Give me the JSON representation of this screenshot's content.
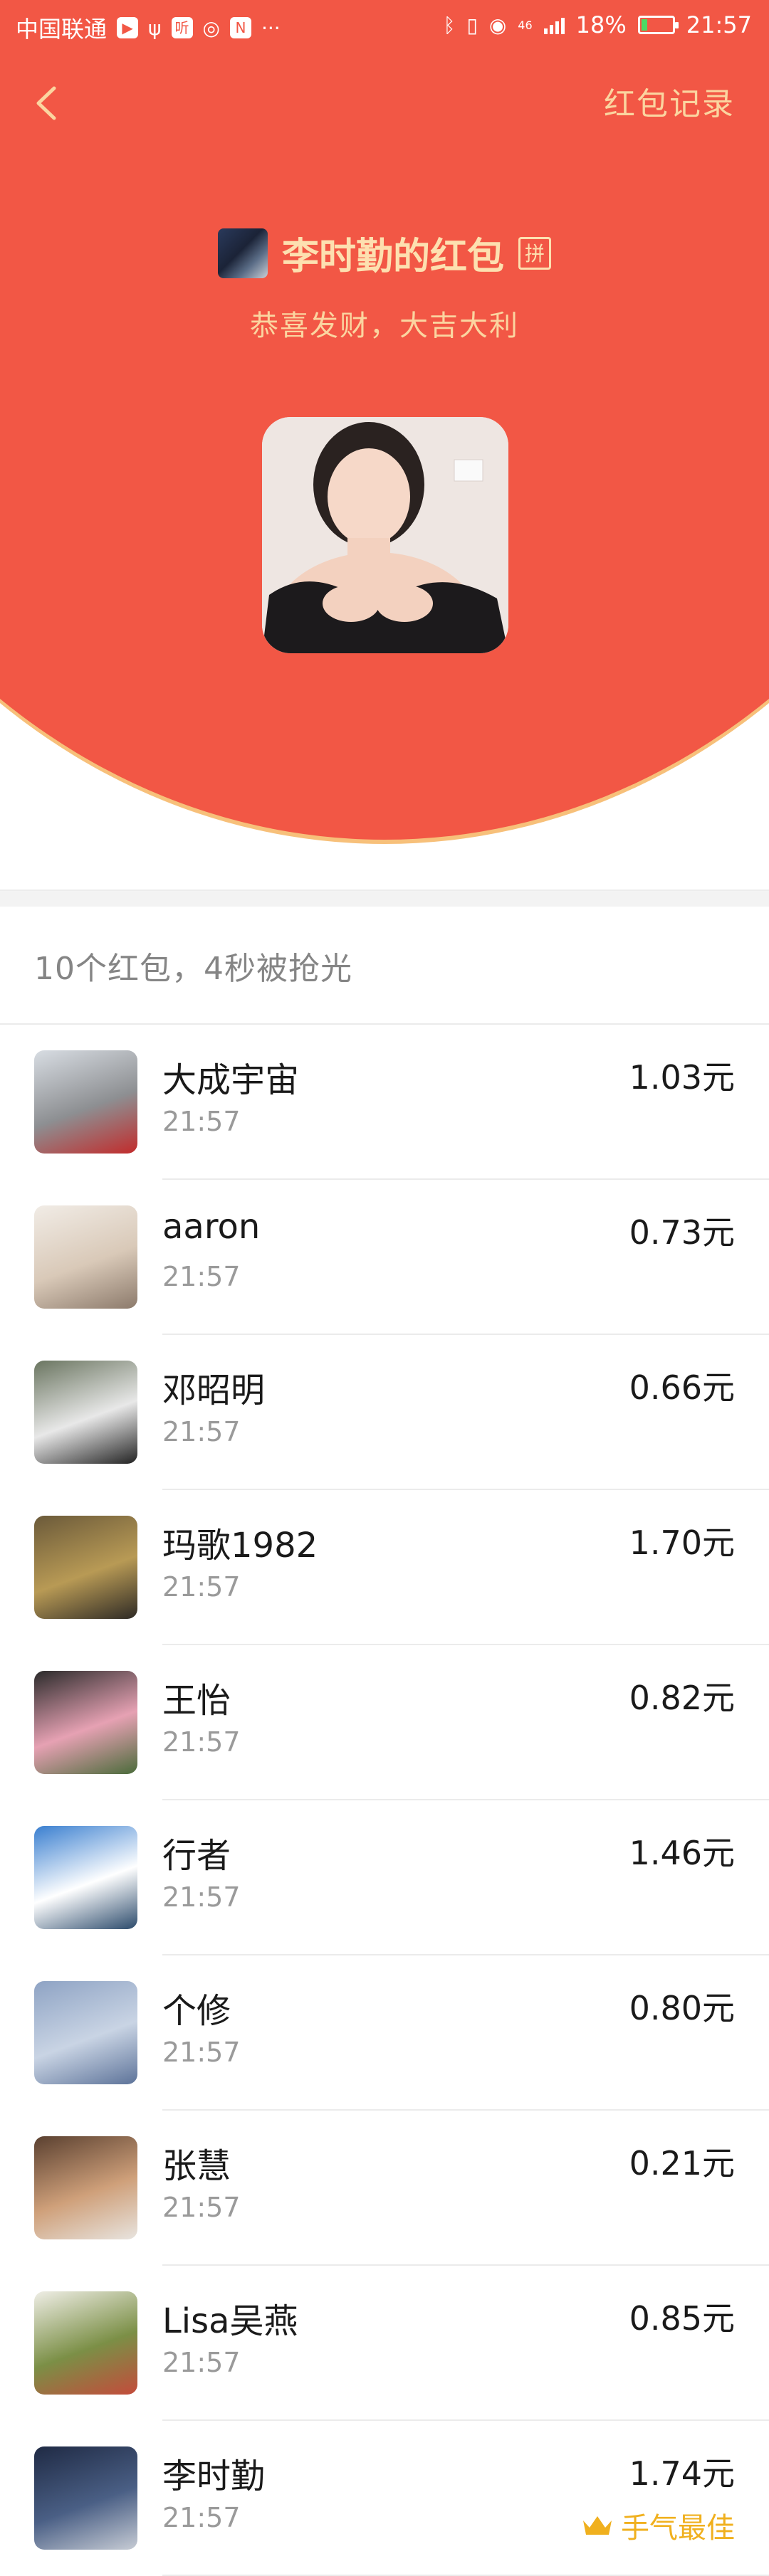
{
  "status_bar": {
    "carrier": "中国联通",
    "network": "46",
    "battery": "18%",
    "battery_level": 0.18,
    "time": "21:57"
  },
  "header": {
    "records_link": "红包记录",
    "sender_title": "李时勤的红包",
    "pin_badge": "拼",
    "greeting": "恭喜发财，大吉大利"
  },
  "summary": "10个红包，4秒被抢光",
  "list": [
    {
      "name": "大成宇宙",
      "time": "21:57",
      "amount": "1.03元",
      "avatar_colors": [
        "#d8dde3",
        "#8d8f92",
        "#c22b2b"
      ]
    },
    {
      "name": "aaron",
      "time": "21:57",
      "amount": "0.73元",
      "avatar_colors": [
        "#f1ece6",
        "#d9c9b8",
        "#8c7a6b"
      ]
    },
    {
      "name": "邓昭明",
      "time": "21:57",
      "amount": "0.66元",
      "avatar_colors": [
        "#6a7560",
        "#e8e8e8",
        "#222222"
      ]
    },
    {
      "name": "玛歌1982",
      "time": "21:57",
      "amount": "1.70元",
      "avatar_colors": [
        "#6b5a3a",
        "#b89a55",
        "#2e2a25"
      ]
    },
    {
      "name": "王怡",
      "time": "21:57",
      "amount": "0.82元",
      "avatar_colors": [
        "#2b2b2b",
        "#e6a1b3",
        "#4a6b3a"
      ]
    },
    {
      "name": "行者",
      "time": "21:57",
      "amount": "1.46元",
      "avatar_colors": [
        "#3a7fd0",
        "#ffffff",
        "#2b4a6b"
      ]
    },
    {
      "name": "个修",
      "time": "21:57",
      "amount": "0.80元",
      "avatar_colors": [
        "#8ea3c4",
        "#c9d4e4",
        "#5d7399"
      ]
    },
    {
      "name": "张慧",
      "time": "21:57",
      "amount": "0.21元",
      "avatar_colors": [
        "#5a4030",
        "#cfa07a",
        "#e8e4df"
      ]
    },
    {
      "name": "Lisa吴燕",
      "time": "21:57",
      "amount": "0.85元",
      "avatar_colors": [
        "#efeee6",
        "#7b8f46",
        "#c44b3b"
      ]
    },
    {
      "name": "李时勤",
      "time": "21:57",
      "amount": "1.74元",
      "avatar_colors": [
        "#1f2a44",
        "#4a5f85",
        "#c7ccd5"
      ],
      "best_label": "手气最佳"
    }
  ],
  "colors": {
    "header_red": "#f25745",
    "gold_text": "#fde0b0",
    "best_gold": "#f0b01e"
  },
  "icons": [
    "chevron-left-icon",
    "crown-icon",
    "bluetooth-icon",
    "vibrate-icon",
    "eye-icon",
    "signal-icon",
    "battery-icon"
  ]
}
